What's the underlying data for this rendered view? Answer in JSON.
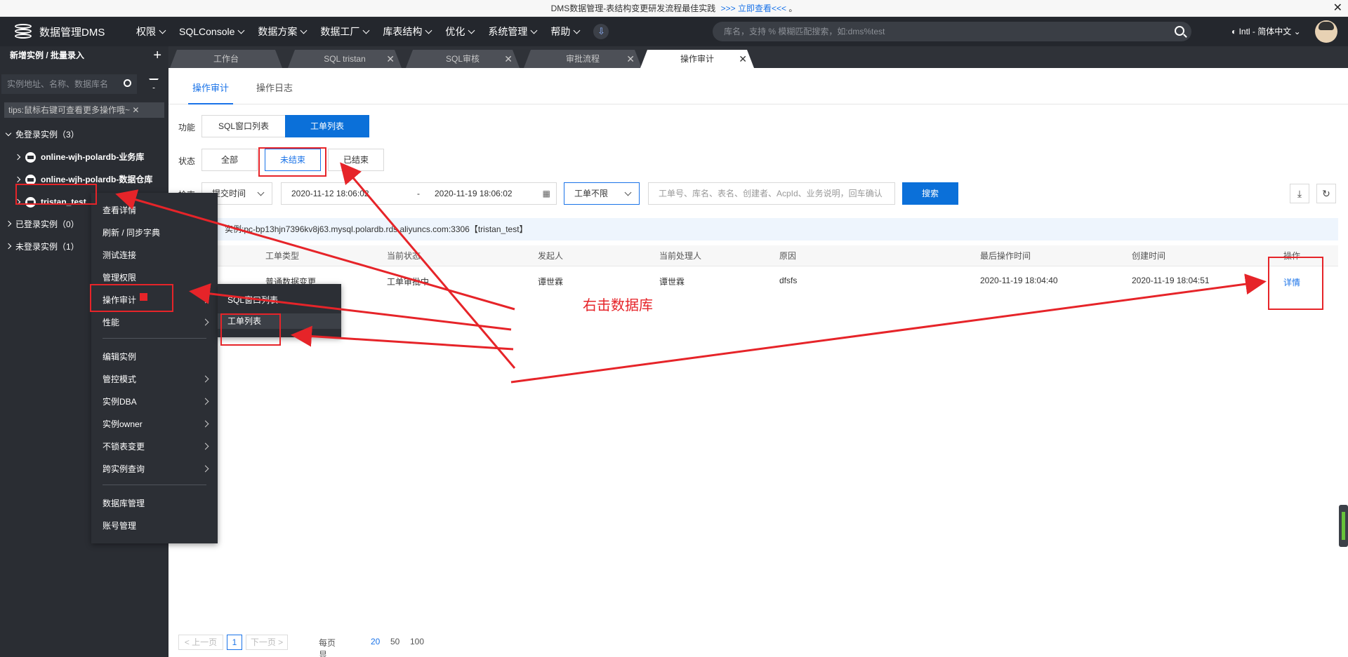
{
  "banner": {
    "text": "DMS数据管理-表结构变更研发流程最佳实践",
    "link": ">>> 立即查看<<<",
    "tail": "。",
    "close": "✕"
  },
  "topnav": {
    "logo": "数据管理DMS",
    "menu": [
      "权限",
      "SQLConsole",
      "数据方案",
      "数据工厂",
      "库表结构",
      "优化",
      "系统管理",
      "帮助"
    ],
    "search_placeholder": "库名，支持 % 模糊匹配搜索，如:dms%test",
    "lang": "Intl - 简体中文"
  },
  "sidebar": {
    "header": "新增实例 / 批量录入",
    "search_placeholder": "实例地址、名称、数据库名",
    "tip": "tips:鼠标右键可查看更多操作哦~",
    "groups": [
      {
        "label": "免登录实例（3）"
      },
      {
        "label": "已登录实例（0）"
      },
      {
        "label": "未登录实例（1）"
      }
    ],
    "instances": [
      "online-wjh-polardb-业务库",
      "online-wjh-polardb-数据仓库",
      "tristan_test"
    ]
  },
  "tabs": [
    {
      "label": "工作台"
    },
    {
      "label": "SQL tristan"
    },
    {
      "label": "SQL审核"
    },
    {
      "label": "审批流程"
    },
    {
      "label": "操作审计"
    }
  ],
  "subtabs": [
    "操作审计",
    "操作日志"
  ],
  "filters": {
    "func_label": "功能",
    "func_options": [
      "SQL窗口列表",
      "工单列表"
    ],
    "state_label": "状态",
    "state_options": [
      "全部",
      "未结束",
      "已结束"
    ],
    "time_label": "检索",
    "time_type": "提交时间",
    "date_start": "2020-11-12 18:06:02",
    "date_sep": "-",
    "date_end": "2020-11-19 18:06:02",
    "order_type": "工单不限",
    "keyword_placeholder": "工单号、库名、表名、创建者、AcpId、业务说明，回车确认",
    "search_btn": "搜索"
  },
  "infobar": "实例:pc-bp13hjn7396kv8j63.mysql.polardb.rds.aliyuncs.com:3306【tristan_test】",
  "table": {
    "headers": [
      "工单类型",
      "当前状态",
      "发起人",
      "当前处理人",
      "原因",
      "最后操作时间",
      "创建时间",
      "操作"
    ],
    "rows": [
      [
        "普通数据变更",
        "工单审批中",
        "谭世霖",
        "谭世霖",
        "dfsfs",
        "2020-11-19 18:04:40",
        "2020-11-19 18:04:51",
        "详情"
      ]
    ]
  },
  "pager": {
    "prev": "< 上一页",
    "page": "1",
    "next": "下一页 >",
    "size_label": "每页显示：",
    "sizes": [
      "20",
      "50",
      "100"
    ]
  },
  "context_menu": [
    "查看详情",
    "刷新 / 同步字典",
    "测试连接",
    "管理权限",
    "操作审计",
    "性能",
    "编辑实例",
    "管控模式",
    "实例DBA",
    "实例owner",
    "不锁表变更",
    "跨实例查询",
    "数据库管理",
    "账号管理"
  ],
  "submenu": [
    "SQL窗口列表",
    "工单列表"
  ],
  "annotation": "右击数据库",
  "colors": {
    "accent": "#0b70d9",
    "annotation": "#e62429",
    "nav_bg": "#24272d",
    "sidebar_bg": "#2a2d33"
  }
}
